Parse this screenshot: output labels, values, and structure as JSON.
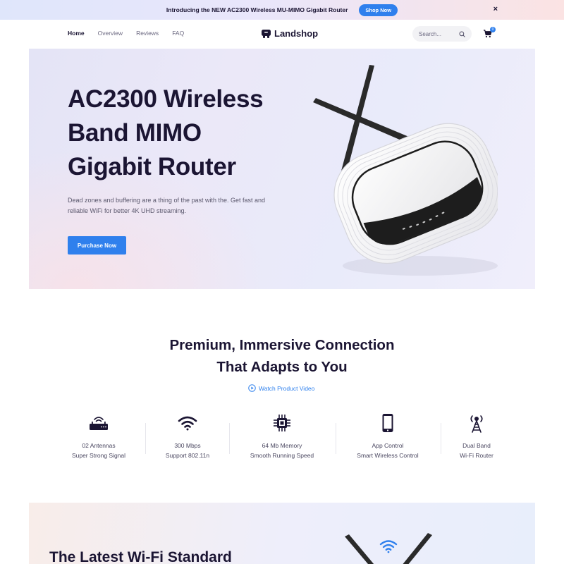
{
  "announcement": {
    "text": "Introducing the NEW AC2300 Wireless MU-MIMO Gigabit Router",
    "cta": "Shop Now",
    "close": "×"
  },
  "header": {
    "nav": [
      {
        "label": "Home",
        "active": true
      },
      {
        "label": "Overview",
        "active": false
      },
      {
        "label": "Reviews",
        "active": false
      },
      {
        "label": "FAQ",
        "active": false
      }
    ],
    "logo": "Landshop",
    "search_placeholder": "Search...",
    "cart_count": "0",
    "icons": {
      "search": "search-icon",
      "cart": "cart-icon",
      "logo": "landshop-logo-icon"
    }
  },
  "hero": {
    "title_lines": [
      "AC2300 Wireless",
      "Band MIMO",
      "Gigabit Router"
    ],
    "description": "Dead zones and buffering are a thing of the past with the. Get fast and reliable WiFi for better 4K UHD streaming.",
    "button": "Purchase Now"
  },
  "section": {
    "title_lines": [
      "Premium, Immersive Connection",
      "That Adapts to You"
    ],
    "video_link": "Watch Product Video"
  },
  "features": [
    {
      "icon": "router-icon",
      "line1": "02 Antennas",
      "line2": "Super Strong Signal"
    },
    {
      "icon": "wifi-icon",
      "line1": "300 Mbps",
      "line2": "Support 802.11n"
    },
    {
      "icon": "chip-icon",
      "line1": "64 Mb Memory",
      "line2": "Smooth Running Speed"
    },
    {
      "icon": "phone-icon",
      "line1": "App Control",
      "line2": "Smart Wireless Control"
    },
    {
      "icon": "antenna-tower-icon",
      "line1": "Dual Band",
      "line2": "Wi-Fi Router"
    }
  ],
  "next_section": {
    "title": "The Latest Wi-Fi Standard"
  },
  "colors": {
    "accent": "#2f80ed",
    "text": "#1b1533"
  }
}
